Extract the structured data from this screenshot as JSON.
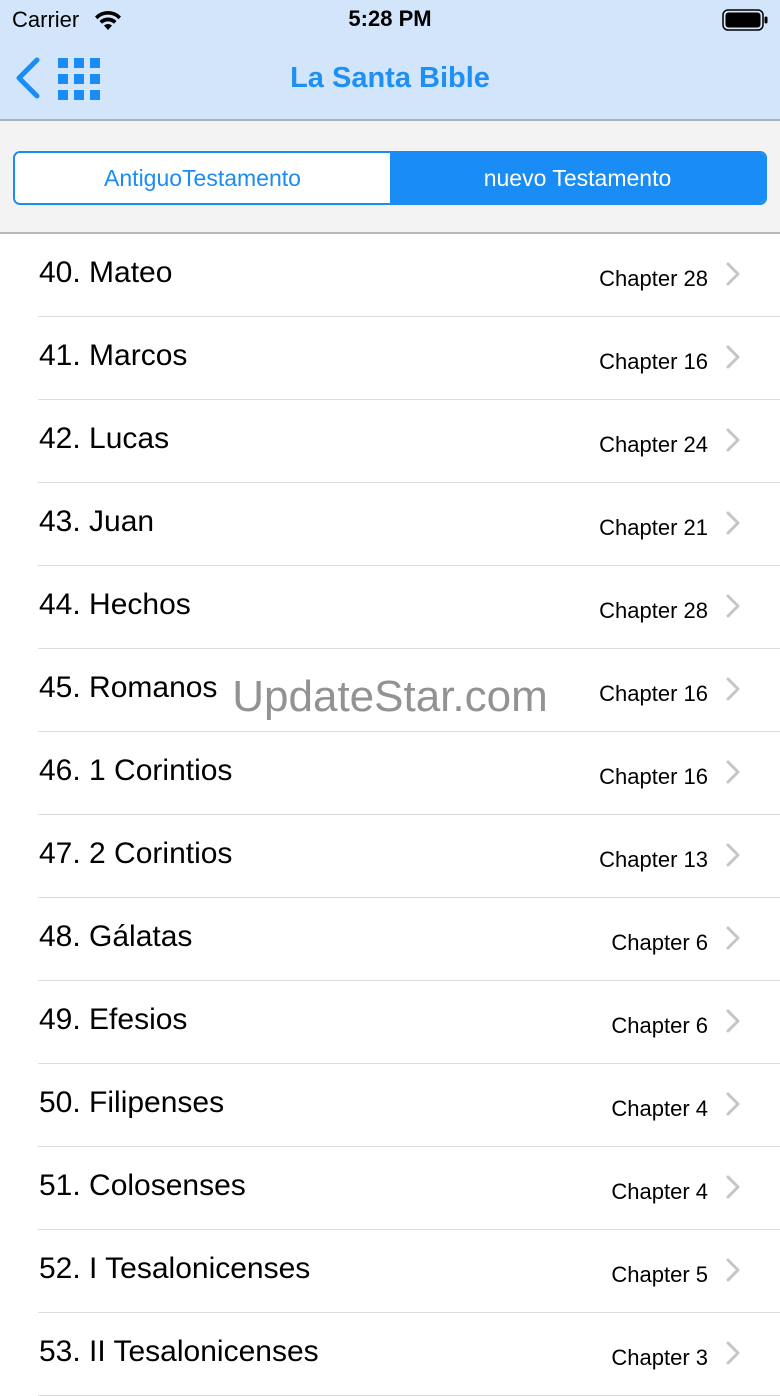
{
  "status_bar": {
    "carrier": "Carrier",
    "wifi_icon": "wifi-icon",
    "time": "5:28 PM",
    "battery_icon": "battery-icon"
  },
  "nav": {
    "title": "La Santa Bible",
    "back_icon": "chevron-left-icon",
    "grid_icon": "grid-icon"
  },
  "colors": {
    "header_bg": "#d2e5fb",
    "accent": "#1a8cf5",
    "title": "#1e90f4"
  },
  "segments": [
    {
      "label": "AntiguoTestamento",
      "selected": false
    },
    {
      "label": "nuevo Testamento",
      "selected": true
    }
  ],
  "books": [
    {
      "name": "40. Mateo",
      "chapters": "Chapter 28"
    },
    {
      "name": "41. Marcos",
      "chapters": "Chapter 16"
    },
    {
      "name": "42. Lucas",
      "chapters": "Chapter 24"
    },
    {
      "name": "43. Juan",
      "chapters": "Chapter 21"
    },
    {
      "name": "44. Hechos",
      "chapters": "Chapter 28"
    },
    {
      "name": "45. Romanos",
      "chapters": "Chapter 16"
    },
    {
      "name": "46. 1 Corintios",
      "chapters": "Chapter 16"
    },
    {
      "name": "47. 2 Corintios",
      "chapters": "Chapter 13"
    },
    {
      "name": "48. Gálatas",
      "chapters": "Chapter 6"
    },
    {
      "name": "49. Efesios",
      "chapters": "Chapter 6"
    },
    {
      "name": "50. Filipenses",
      "chapters": "Chapter 4"
    },
    {
      "name": "51. Colosenses",
      "chapters": "Chapter 4"
    },
    {
      "name": "52. I Tesalonicenses",
      "chapters": "Chapter 5"
    },
    {
      "name": "53. II Tesalonicenses",
      "chapters": "Chapter 3"
    }
  ],
  "watermark": "UpdateStar.com"
}
